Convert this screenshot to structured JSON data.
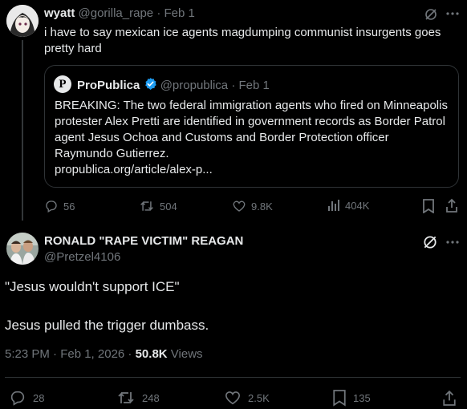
{
  "tweet1": {
    "author_name": "wyatt",
    "handle": "@gorilla_rape",
    "date": "Feb 1",
    "text": "i have to say mexican ice agents magdumping communist insurgents goes pretty hard",
    "quote": {
      "avatar_letter": "P",
      "author_name": "ProPublica",
      "handle": "@propublica",
      "date": "Feb 1",
      "text": "BREAKING: The two federal immigration agents who fired on Minneapolis protester Alex Pretti are identified in government records as Border Patrol agent Jesus Ochoa and Customs and Border Protection officer Raymundo Gutierrez.",
      "link": "propublica.org/article/alex-p..."
    },
    "stats": {
      "replies": "56",
      "reposts": "504",
      "likes": "9.8K",
      "views": "404K"
    }
  },
  "tweet2": {
    "author_name": "RONALD \"RAPE VICTIM\" REAGAN",
    "handle": "@Pretzel4106",
    "line1": "\"Jesus wouldn't support ICE\"",
    "line2": "Jesus pulled the trigger dumbass.",
    "timestamp": "5:23 PM · Feb 1, 2026 · ",
    "views_count": "50.8K",
    "views_label": " Views",
    "stats": {
      "replies": "28",
      "reposts": "248",
      "likes": "2.5K",
      "bookmarks": "135"
    }
  },
  "colors": {
    "background": "#000000",
    "text": "#e7e9ea",
    "muted": "#71767b",
    "border": "#2f3336",
    "verified": "#1d9bf0"
  }
}
